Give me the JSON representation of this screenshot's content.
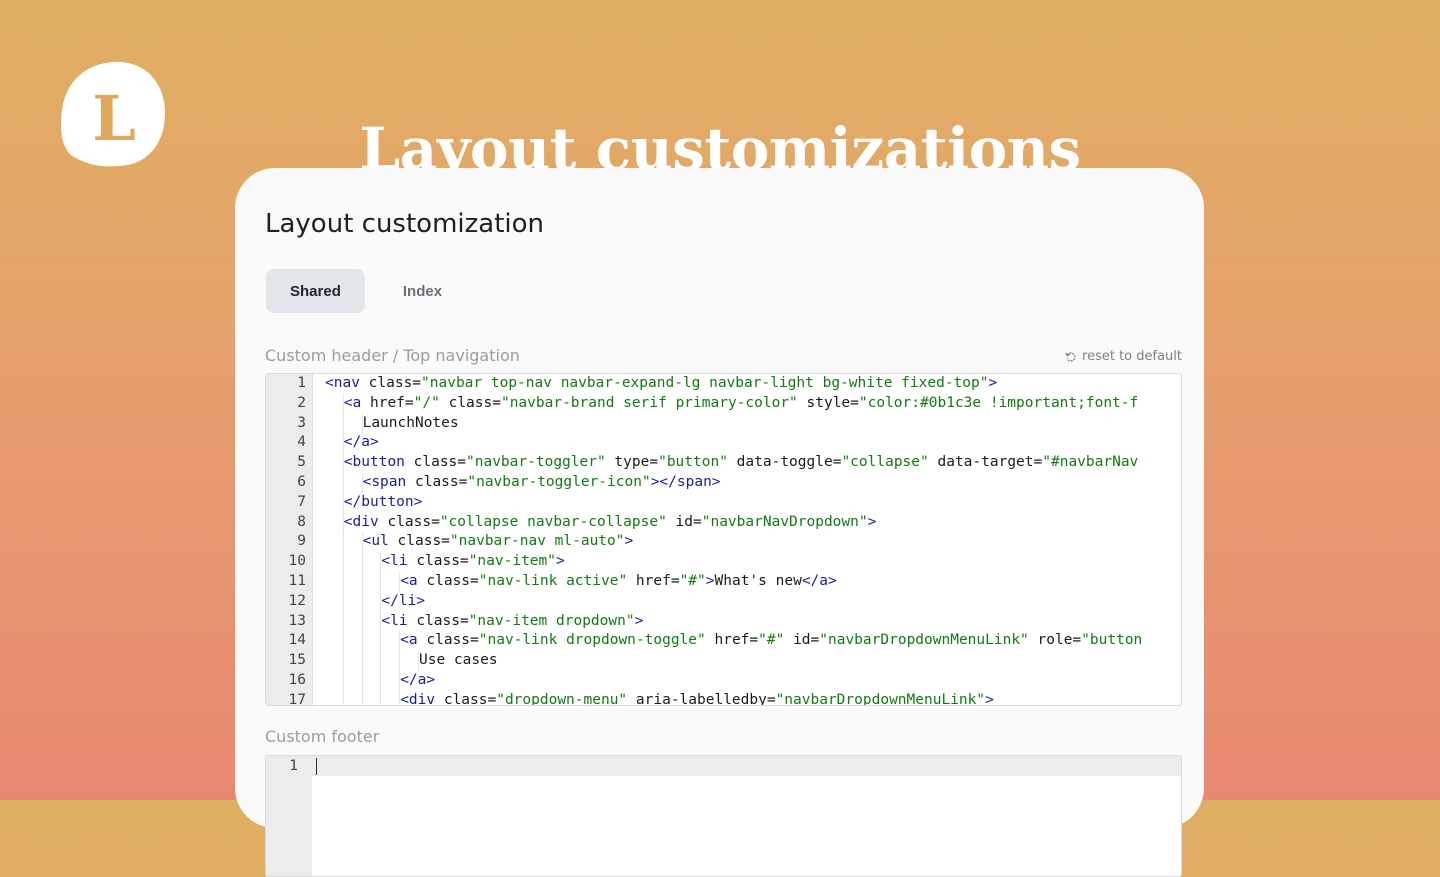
{
  "hero": {
    "logo_letter": "L",
    "title": "Layout customizations"
  },
  "card": {
    "title": "Layout customization",
    "tabs": [
      {
        "label": "Shared",
        "active": true
      },
      {
        "label": "Index",
        "active": false
      }
    ],
    "header_field": {
      "label": "Custom header / Top navigation",
      "reset_label": "reset to default"
    },
    "footer_field": {
      "label": "Custom footer",
      "line_numbers": [
        "1"
      ]
    }
  },
  "code_lines": [
    {
      "n": "1",
      "indent": 0,
      "tokens": [
        [
          "t",
          "<nav"
        ],
        [
          "a",
          " class="
        ],
        [
          "s",
          "\"navbar top-nav navbar-expand-lg navbar-light bg-white fixed-top\""
        ],
        [
          "t",
          ">"
        ]
      ]
    },
    {
      "n": "2",
      "indent": 1,
      "tokens": [
        [
          "t",
          "<a"
        ],
        [
          "a",
          " href="
        ],
        [
          "s",
          "\"/\""
        ],
        [
          "a",
          " class="
        ],
        [
          "s",
          "\"navbar-brand serif primary-color\""
        ],
        [
          "a",
          " style="
        ],
        [
          "s",
          "\"color:#0b1c3e !important;font-f"
        ]
      ]
    },
    {
      "n": "3",
      "indent": 2,
      "tokens": [
        [
          "a",
          "LaunchNotes"
        ]
      ]
    },
    {
      "n": "4",
      "indent": 1,
      "tokens": [
        [
          "t",
          "</a>"
        ]
      ]
    },
    {
      "n": "5",
      "indent": 1,
      "tokens": [
        [
          "t",
          "<button"
        ],
        [
          "a",
          " class="
        ],
        [
          "s",
          "\"navbar-toggler\""
        ],
        [
          "a",
          " type="
        ],
        [
          "s",
          "\"button\""
        ],
        [
          "a",
          " data-toggle="
        ],
        [
          "s",
          "\"collapse\""
        ],
        [
          "a",
          " data-target="
        ],
        [
          "s",
          "\"#navbarNav"
        ]
      ]
    },
    {
      "n": "6",
      "indent": 2,
      "tokens": [
        [
          "t",
          "<span"
        ],
        [
          "a",
          " class="
        ],
        [
          "s",
          "\"navbar-toggler-icon\""
        ],
        [
          "t",
          "></span>"
        ]
      ]
    },
    {
      "n": "7",
      "indent": 1,
      "tokens": [
        [
          "t",
          "</button>"
        ]
      ]
    },
    {
      "n": "8",
      "indent": 1,
      "tokens": [
        [
          "t",
          "<div"
        ],
        [
          "a",
          " class="
        ],
        [
          "s",
          "\"collapse navbar-collapse\""
        ],
        [
          "a",
          " id="
        ],
        [
          "s",
          "\"navbarNavDropdown\""
        ],
        [
          "t",
          ">"
        ]
      ]
    },
    {
      "n": "9",
      "indent": 2,
      "tokens": [
        [
          "t",
          "<ul"
        ],
        [
          "a",
          " class="
        ],
        [
          "s",
          "\"navbar-nav ml-auto\""
        ],
        [
          "t",
          ">"
        ]
      ]
    },
    {
      "n": "10",
      "indent": 3,
      "tokens": [
        [
          "t",
          "<li"
        ],
        [
          "a",
          " class="
        ],
        [
          "s",
          "\"nav-item\""
        ],
        [
          "t",
          ">"
        ]
      ]
    },
    {
      "n": "11",
      "indent": 4,
      "tokens": [
        [
          "t",
          "<a"
        ],
        [
          "a",
          " class="
        ],
        [
          "s",
          "\"nav-link active\""
        ],
        [
          "a",
          " href="
        ],
        [
          "s",
          "\"#\""
        ],
        [
          "t",
          ">"
        ],
        [
          "a",
          "What's new"
        ],
        [
          "t",
          "</a>"
        ]
      ]
    },
    {
      "n": "12",
      "indent": 3,
      "tokens": [
        [
          "t",
          "</li>"
        ]
      ]
    },
    {
      "n": "13",
      "indent": 3,
      "tokens": [
        [
          "t",
          "<li"
        ],
        [
          "a",
          " class="
        ],
        [
          "s",
          "\"nav-item dropdown\""
        ],
        [
          "t",
          ">"
        ]
      ]
    },
    {
      "n": "14",
      "indent": 4,
      "tokens": [
        [
          "t",
          "<a"
        ],
        [
          "a",
          " class="
        ],
        [
          "s",
          "\"nav-link dropdown-toggle\""
        ],
        [
          "a",
          " href="
        ],
        [
          "s",
          "\"#\""
        ],
        [
          "a",
          " id="
        ],
        [
          "s",
          "\"navbarDropdownMenuLink\""
        ],
        [
          "a",
          " role="
        ],
        [
          "s",
          "\"button"
        ]
      ]
    },
    {
      "n": "15",
      "indent": 5,
      "tokens": [
        [
          "a",
          "Use cases"
        ]
      ]
    },
    {
      "n": "16",
      "indent": 4,
      "tokens": [
        [
          "t",
          "</a>"
        ]
      ]
    },
    {
      "n": "17",
      "indent": 4,
      "tokens": [
        [
          "t",
          "<div"
        ],
        [
          "a",
          " class="
        ],
        [
          "s",
          "\"dropdown-menu\""
        ],
        [
          "a",
          " aria-labelledby="
        ],
        [
          "s",
          "\"navbarDropdownMenuLink\""
        ],
        [
          "t",
          ">"
        ]
      ]
    }
  ],
  "colors": {
    "gradient_top": "#e0b062",
    "gradient_bottom": "#e98872",
    "logo_letter": "#e0a85a",
    "tag": "#1c1c94",
    "string": "#127a12"
  },
  "icons": {
    "reset": "reset-icon",
    "logo": "logo-blob"
  }
}
